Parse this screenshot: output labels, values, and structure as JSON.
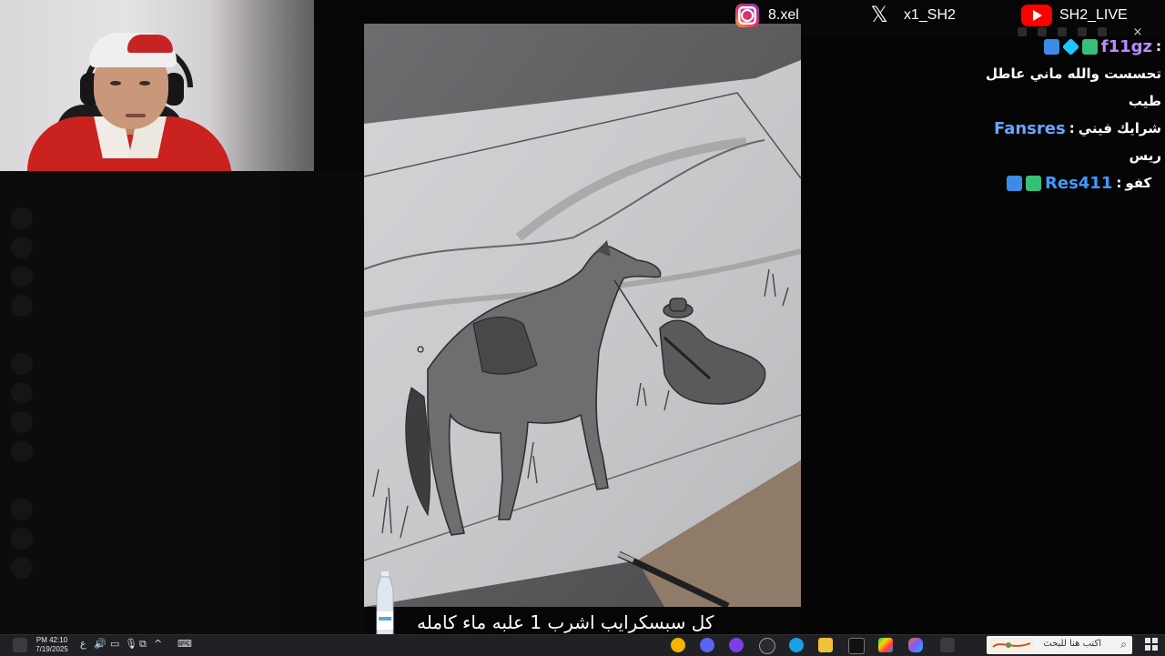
{
  "social": {
    "instagram_icon": "instagram-icon",
    "instagram_handle": "8.xel",
    "x_icon": "x-icon",
    "x_handle": "x1_SH2",
    "youtube_icon": "youtube-icon",
    "youtube_handle": "SH2_LIVE"
  },
  "window": {
    "close_glyph": "×"
  },
  "chat": {
    "messages": [
      {
        "badges": [
          "hammer",
          "cube",
          "og"
        ],
        "user": "f11gz",
        "user_color": "#b98cff",
        "separator": ":",
        "text_lines": [
          "تحسست والله ماني عاطل",
          "طيب"
        ]
      },
      {
        "badges": [],
        "user": "Fansres",
        "user_color": "#6aa6ff",
        "separator": ":",
        "text": "شرايك فيني",
        "text_lines": [
          "ريس"
        ]
      },
      {
        "badges": [
          "hammer",
          "og"
        ],
        "user": "Res411",
        "user_color": "#3d9bff",
        "separator": ":",
        "text": "كفو"
      }
    ]
  },
  "caption": {
    "text": "كل سبسكرايب اشرب 1 علبه ماء كامله"
  },
  "taskbar": {
    "time": "PM 42:10",
    "date": "7/19/2025",
    "lang": "ع",
    "search_placeholder": "اكتب هنا للبحث",
    "search_icon": "search-icon",
    "start_icon": "windows-start-icon",
    "apps": [
      "chrome-icon",
      "discord-icon",
      "kick-icon",
      "obs-icon",
      "edge-icon",
      "file-explorer-icon",
      "epic-games-icon",
      "google-play-icon",
      "copilot-icon",
      "task-view-icon"
    ]
  },
  "colors": {
    "accent_red": "#c9221f",
    "youtube_red": "#ff0000",
    "taskbar_bg": "#202124"
  }
}
